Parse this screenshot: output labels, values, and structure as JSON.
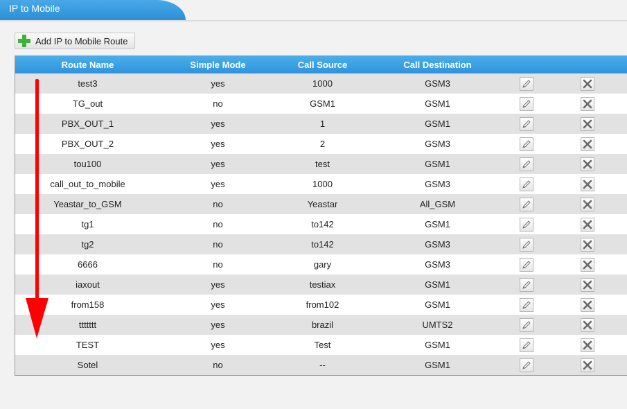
{
  "tab": {
    "title": "IP to Mobile"
  },
  "toolbar": {
    "add_label": "Add IP to Mobile Route"
  },
  "table": {
    "headers": [
      "Route Name",
      "Simple Mode",
      "Call Source",
      "Call Destination"
    ],
    "rows": [
      {
        "name": "test3",
        "mode": "yes",
        "source": "1000",
        "dest": "GSM3"
      },
      {
        "name": "TG_out",
        "mode": "no",
        "source": "GSM1",
        "dest": "GSM1"
      },
      {
        "name": "PBX_OUT_1",
        "mode": "yes",
        "source": "1",
        "dest": "GSM1"
      },
      {
        "name": "PBX_OUT_2",
        "mode": "yes",
        "source": "2",
        "dest": "GSM3"
      },
      {
        "name": "tou100",
        "mode": "yes",
        "source": "test",
        "dest": "GSM1"
      },
      {
        "name": "call_out_to_mobile",
        "mode": "yes",
        "source": "1000",
        "dest": "GSM3"
      },
      {
        "name": "Yeastar_to_GSM",
        "mode": "no",
        "source": "Yeastar",
        "dest": "All_GSM"
      },
      {
        "name": "tg1",
        "mode": "no",
        "source": "to142",
        "dest": "GSM1"
      },
      {
        "name": "tg2",
        "mode": "no",
        "source": "to142",
        "dest": "GSM3"
      },
      {
        "name": "6666",
        "mode": "no",
        "source": "gary",
        "dest": "GSM3"
      },
      {
        "name": "iaxout",
        "mode": "yes",
        "source": "testiax",
        "dest": "GSM1"
      },
      {
        "name": "from158",
        "mode": "yes",
        "source": "from102",
        "dest": "GSM1"
      },
      {
        "name": "ttttttt",
        "mode": "yes",
        "source": "brazil",
        "dest": "UMTS2"
      },
      {
        "name": "TEST",
        "mode": "yes",
        "source": "Test",
        "dest": "GSM1"
      },
      {
        "name": "Sotel",
        "mode": "no",
        "source": "--",
        "dest": "GSM1"
      }
    ]
  },
  "colors": {
    "accent": "#2e93dd",
    "arrow": "#ff0000",
    "add_icon": "#3fb23a"
  },
  "icons": {
    "edit": "pencil-icon",
    "delete": "x-icon",
    "add": "plus-icon",
    "annotation": "down-arrow"
  }
}
